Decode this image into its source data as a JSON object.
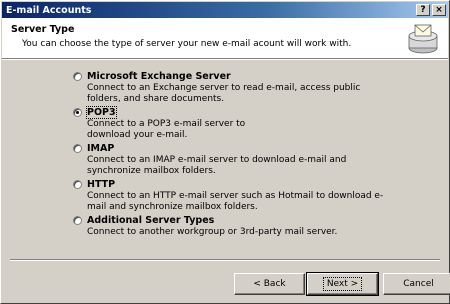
{
  "window": {
    "title": "E-mail Accounts",
    "help_button": "?",
    "close_button": "×"
  },
  "header": {
    "title": "Server Type",
    "description": "You can choose the type of server your new e-mail acount will work with."
  },
  "options": [
    {
      "label": "Microsoft Exchange Server",
      "selected": false,
      "description": "Connect to an Exchange server to read e-mail, access public folders, and share documents."
    },
    {
      "label": "POP3",
      "selected": true,
      "description": "Connect to a POP3 e-mail server to download your e-mail."
    },
    {
      "label": "IMAP",
      "selected": false,
      "description": "Connect to an IMAP e-mail server to download e-mail and synchronize mailbox folders."
    },
    {
      "label": "HTTP",
      "selected": false,
      "description": "Connect to an HTTP e-mail server such as Hotmail to download e-mail and synchronize mailbox folders."
    },
    {
      "label": "Additional Server Types",
      "selected": false,
      "description": "Connect to another workgroup or 3rd-party mail server."
    }
  ],
  "buttons": {
    "back": "< Back",
    "next": "Next >",
    "cancel": "Cancel"
  }
}
